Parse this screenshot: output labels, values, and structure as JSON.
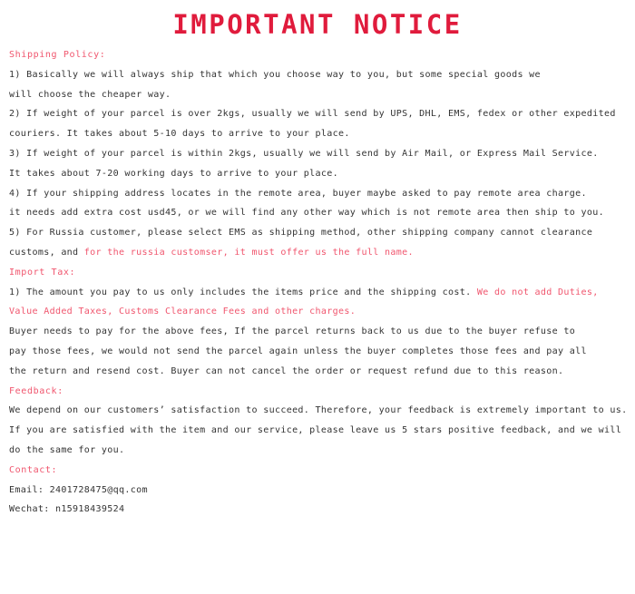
{
  "document": {
    "title": "IMPORTANT NOTICE",
    "title_color": "#e01b3c",
    "accent_color": "#f0566e",
    "body_color": "#333333",
    "background_color": "#ffffff"
  },
  "sections": {
    "shipping": {
      "heading": "Shipping Policy:",
      "items": [
        {
          "lines": [
            "1) Basically we will always ship that which you choose way to you, but some special goods we",
            "will choose the cheaper way."
          ]
        },
        {
          "lines": [
            "2) If weight of your parcel is over 2kgs, usually we will send by UPS, DHL, EMS, fedex or other expedited",
            "couriers. It takes about 5-10 days to arrive to your place."
          ]
        },
        {
          "lines": [
            "3) If weight of your parcel is within 2kgs, usually we will send by Air Mail, or Express Mail Service.",
            "It takes about 7-20 working days to arrive to your place."
          ]
        },
        {
          "lines": [
            "4) If your shipping address locates in the remote area, buyer maybe asked to pay remote area charge.",
            "it needs add extra cost usd45, or we will find any other way which is not remote area then ship to you."
          ]
        },
        {
          "lines": [
            "5) For Russia customer, please select EMS as shipping method, other shipping company cannot clearance",
            "customs, and "
          ],
          "line2_plain": "customs, and ",
          "line2_accent": "for the russia customser, it must offer us the full name."
        }
      ]
    },
    "import_tax": {
      "heading": "Import Tax:",
      "item1_line1_plain": "1) The amount you pay to us only includes the items price and the shipping cost. ",
      "item1_line1_accent": "We do not add Duties,",
      "item1_line2_accent": "Value Added Taxes, Customs Clearance Fees and other charges.",
      "paragraph_lines": [
        "Buyer needs to pay for the above fees, If the parcel returns back to us due to the buyer refuse to",
        "pay those fees, we would not send the parcel again unless the buyer completes those fees and pay all",
        "the return and resend cost. Buyer can not cancel the order or request refund due to this reason."
      ]
    },
    "feedback": {
      "heading": "Feedback:",
      "lines": [
        "We depend on our customers’ satisfaction to succeed. Therefore, your feedback is extremely important to us.",
        "If you are satisfied with the item and our service, please leave us 5 stars positive feedback, and we will",
        "do the same for you."
      ]
    },
    "contact": {
      "heading": "Contact:",
      "email_line": "Email: 2401728475@qq.com",
      "wechat_line": "Wechat: n15918439524"
    }
  }
}
